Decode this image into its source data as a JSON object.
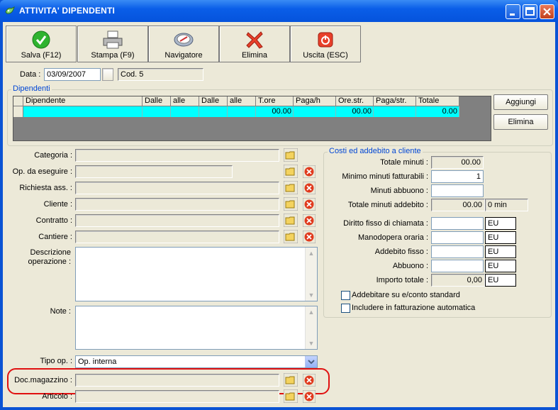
{
  "window": {
    "title": "ATTIVITA' DIPENDENTI"
  },
  "toolbar": {
    "save_label": "Salva (F12)",
    "print_label": "Stampa (F9)",
    "navigator_label": "Navigatore",
    "delete_label": "Elimina",
    "exit_label": "Uscita (ESC)"
  },
  "header": {
    "date_label": "Data :",
    "date_value": "03/09/2007",
    "code_value": "Cod. 5"
  },
  "dipendenti": {
    "group_title": "Dipendenti",
    "columns": [
      "Dipendente",
      "Dalle",
      "alle",
      "Dalle",
      "alle",
      "T.ore",
      "Paga/h",
      "Ore.str.",
      "Paga/str.",
      "Totale"
    ],
    "row": [
      "",
      "",
      "",
      "",
      "",
      "00.00",
      "",
      "00.00",
      "",
      "0.00"
    ],
    "add_label": "Aggiungi",
    "delete_label": "Elimina"
  },
  "form": {
    "categoria_label": "Categoria :",
    "op_eseguire_label": "Op. da eseguire :",
    "richiesta_label": "Richiesta ass. :",
    "cliente_label": "Cliente :",
    "contratto_label": "Contratto :",
    "cantiere_label": "Cantiere :",
    "descrizione_label_1": "Descrizione",
    "descrizione_label_2": "operazione :",
    "note_label": "Note :",
    "tipo_op_label": "Tipo op. :",
    "tipo_op_value": "Op. interna",
    "doc_magazzino_label": "Doc.magazzino :",
    "articolo_label": "Articolo :"
  },
  "costi": {
    "group_title": "Costi ed addebito a cliente",
    "totale_minuti_label": "Totale minuti :",
    "totale_minuti_value": "00.00",
    "minimo_label": "Minimo minuti fatturabili :",
    "minimo_value": "1",
    "abbuono_min_label": "Minuti abbuono :",
    "abbuono_min_value": "",
    "totale_addebito_label": "Totale minuti addebito :",
    "totale_addebito_value": "00.00",
    "totale_addebito_unit": "0 min",
    "diritto_label": "Diritto fisso di chiamata :",
    "manodopera_label": "Manodopera oraria :",
    "addebito_fisso_label": "Addebito fisso :",
    "abbuono_label": "Abbuono :",
    "importo_label": "Importo totale :",
    "importo_value": "0,00",
    "currency": "EU",
    "chk_addebitare_label": "Addebitare su e/conto standard",
    "chk_includere_label": "Includere in fatturazione automatica"
  },
  "colors": {
    "title_blue": "#0a5ee8",
    "grid_row": "#00ffff",
    "highlight": "#e01010"
  }
}
